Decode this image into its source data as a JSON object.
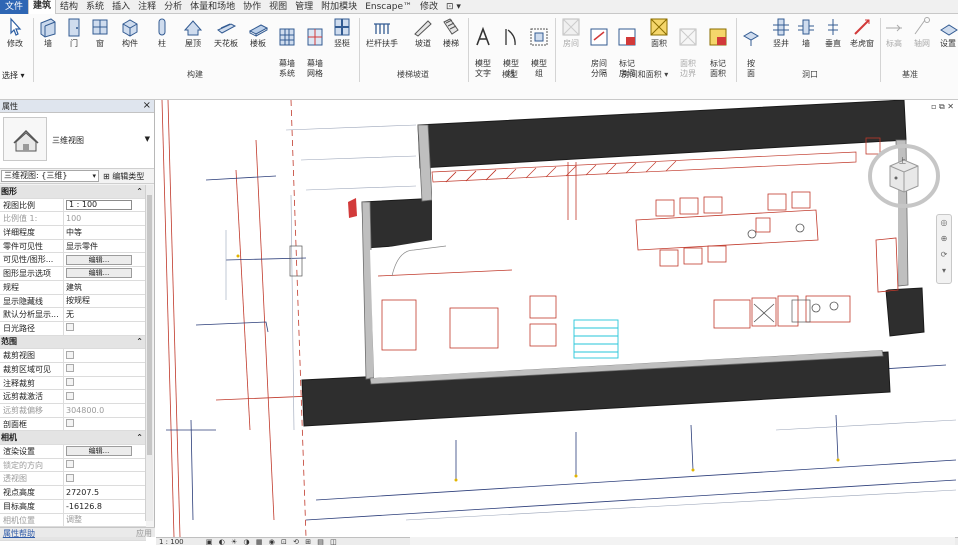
{
  "tabs": [
    {
      "label": "文件",
      "type": "file"
    },
    {
      "label": "建筑",
      "type": "active"
    },
    {
      "label": "结构"
    },
    {
      "label": "系统"
    },
    {
      "label": "插入"
    },
    {
      "label": "注释"
    },
    {
      "label": "分析"
    },
    {
      "label": "体量和场地"
    },
    {
      "label": "协作"
    },
    {
      "label": "视图"
    },
    {
      "label": "管理"
    },
    {
      "label": "附加模块"
    },
    {
      "label": "Enscape™"
    },
    {
      "label": "修改"
    },
    {
      "label": "⊡ ▾"
    }
  ],
  "ribbon": {
    "modify": "修改",
    "select": "选择 ▾",
    "build": {
      "label": "构建",
      "wall": "墙",
      "door": "门",
      "window": "窗",
      "component": "构件",
      "column": "柱",
      "roof": "屋顶",
      "ceiling": "天花板",
      "floor": "楼板",
      "curtain_system": "幕墙\n系统",
      "curtain_grid": "幕墙\n网格",
      "mullion": "竖梃"
    },
    "circulation": {
      "label": "楼梯坡道",
      "railing": "栏杆扶手",
      "ramp": "坡道",
      "stair": "楼梯"
    },
    "model": {
      "label": "模型",
      "text": "模型\n文字",
      "line": "模型\n线",
      "group": "模型\n组"
    },
    "room": {
      "label": "房间和面积 ▾",
      "room": "房间",
      "separator": "房间\n分隔",
      "tag_room": "标记\n房间",
      "area": "面积",
      "area_boundary": "面积\n边界",
      "tag_area": "标记\n面积"
    },
    "opening": {
      "label": "洞口",
      "by_face": "按\n面",
      "shaft": "竖井",
      "wall": "墙",
      "vertical": "垂直",
      "dormer": "老虎窗"
    },
    "datum": {
      "label": "基准",
      "level": "标高",
      "grid": "轴网",
      "set": "设置"
    }
  },
  "properties": {
    "title": "属性",
    "close": "×",
    "type_name": "三维视图",
    "filter": "三维视图: {三维}",
    "edit_type": "编辑类型",
    "rows": [
      {
        "kind": "cat",
        "label": "图形"
      },
      {
        "label": "视图比例",
        "value": "1 : 100",
        "ctl": "input"
      },
      {
        "label": "比例值 1:",
        "value": "100",
        "dim": true
      },
      {
        "label": "详细程度",
        "value": "中等"
      },
      {
        "label": "零件可见性",
        "value": "显示零件"
      },
      {
        "label": "可见性/图形...",
        "value": "编辑...",
        "ctl": "button"
      },
      {
        "label": "图形显示选项",
        "value": "编辑...",
        "ctl": "button"
      },
      {
        "label": "规程",
        "value": "建筑"
      },
      {
        "label": "显示隐藏线",
        "value": "按规程"
      },
      {
        "label": "默认分析显示...",
        "value": "无"
      },
      {
        "label": "日光路径",
        "value": "",
        "ctl": "check"
      },
      {
        "kind": "cat",
        "label": "范围"
      },
      {
        "label": "裁剪视图",
        "value": "",
        "ctl": "check"
      },
      {
        "label": "裁剪区域可见",
        "value": "",
        "ctl": "check"
      },
      {
        "label": "注释裁剪",
        "value": "",
        "ctl": "check"
      },
      {
        "label": "远剪裁激活",
        "value": "",
        "ctl": "check"
      },
      {
        "label": "远剪裁偏移",
        "value": "304800.0",
        "dim": true
      },
      {
        "label": "剖面框",
        "value": "",
        "ctl": "check"
      },
      {
        "kind": "cat",
        "label": "相机"
      },
      {
        "label": "渲染设置",
        "value": "编辑...",
        "ctl": "button"
      },
      {
        "label": "锁定的方向",
        "value": "",
        "ctl": "check",
        "dim": true
      },
      {
        "label": "透视图",
        "value": "",
        "ctl": "check",
        "dim": true
      },
      {
        "label": "视点高度",
        "value": "27207.5"
      },
      {
        "label": "目标高度",
        "value": "-16126.8"
      },
      {
        "label": "相机位置",
        "value": "调整",
        "dim": true
      },
      {
        "kind": "cat",
        "label": "标识数据"
      }
    ],
    "help": "属性帮助",
    "apply": "应用"
  },
  "viewport": {
    "win_controls": "▫ ⧉ ✕",
    "viewcube_face": "上"
  },
  "status": {
    "scale": "1 : 100"
  }
}
